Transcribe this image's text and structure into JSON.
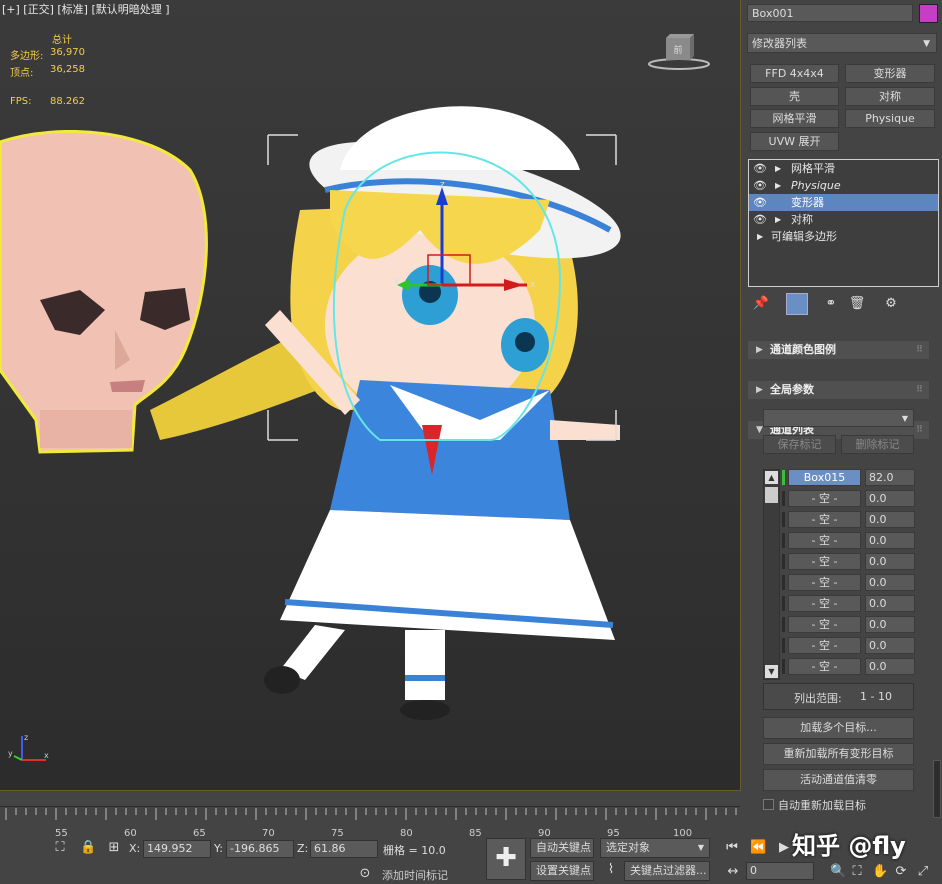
{
  "viewport": {
    "label": "[+] [正交] [标准] [默认明暗处理 ]",
    "stats": {
      "total_label": "总计",
      "polys_label": "多边形:",
      "polys_value": "36,970",
      "verts_label": "顶点:",
      "verts_value": "36,258",
      "fps_label": "FPS:",
      "fps_value": "88.262"
    },
    "viewcube_label": "前",
    "axis_x": "x",
    "axis_y": "y",
    "axis_z": "z",
    "gizmo_z": "z",
    "gizmo_x": "x",
    "gizmo_y": "y"
  },
  "panel": {
    "object_name": "Box001",
    "object_color": "#c43fc4",
    "modifier_list_label": "修改器列表",
    "modifier_buttons": [
      "FFD 4x4x4",
      "变形器",
      "壳",
      "对称",
      "网格平滑",
      "Physique",
      "UVW 展开"
    ],
    "stack": [
      {
        "label": "网格平滑",
        "selected": false
      },
      {
        "label": "Physique",
        "selected": false
      },
      {
        "label": "变形器",
        "selected": true
      },
      {
        "label": "对称",
        "selected": false
      },
      {
        "label": "可编辑多边形",
        "selected": false
      }
    ],
    "rollouts": {
      "channel_color_legend": "通道颜色图例",
      "global_params": "全局参数",
      "channel_list": "通道列表"
    },
    "save_marker": "保存标记",
    "delete_marker": "删除标记",
    "channels": [
      {
        "name": "Box015",
        "value": "82.0",
        "active": true
      },
      {
        "name": "- 空 -",
        "value": "0.0",
        "active": false
      },
      {
        "name": "- 空 -",
        "value": "0.0",
        "active": false
      },
      {
        "name": "- 空 -",
        "value": "0.0",
        "active": false
      },
      {
        "name": "- 空 -",
        "value": "0.0",
        "active": false
      },
      {
        "name": "- 空 -",
        "value": "0.0",
        "active": false
      },
      {
        "name": "- 空 -",
        "value": "0.0",
        "active": false
      },
      {
        "name": "- 空 -",
        "value": "0.0",
        "active": false
      },
      {
        "name": "- 空 -",
        "value": "0.0",
        "active": false
      },
      {
        "name": "- 空 -",
        "value": "0.0",
        "active": false
      }
    ],
    "list_range_label": "列出范围:",
    "list_range_value": "1 - 10",
    "load_multiple": "加载多个目标...",
    "reload_all": "重新加载所有变形目标",
    "zero_active": "活动通道值清零",
    "auto_reload": "自动重新加载目标"
  },
  "timeline": {
    "ticks": [
      "55",
      "60",
      "65",
      "70",
      "75",
      "80",
      "85",
      "90",
      "95",
      "100"
    ]
  },
  "statusbar": {
    "x_label": "X:",
    "x_value": "149.952",
    "y_label": "Y:",
    "y_value": "-196.865",
    "z_label": "Z:",
    "z_value": "61.86",
    "grid_label": "栅格 = 10.0",
    "add_time_tag": "添加时间标记",
    "auto_key": "自动关键点",
    "set_key": "设置关键点",
    "selected_object": "选定对象",
    "key_filters": "关键点过滤器...",
    "frame_value": "0",
    "watermark": "知乎 @fly"
  }
}
